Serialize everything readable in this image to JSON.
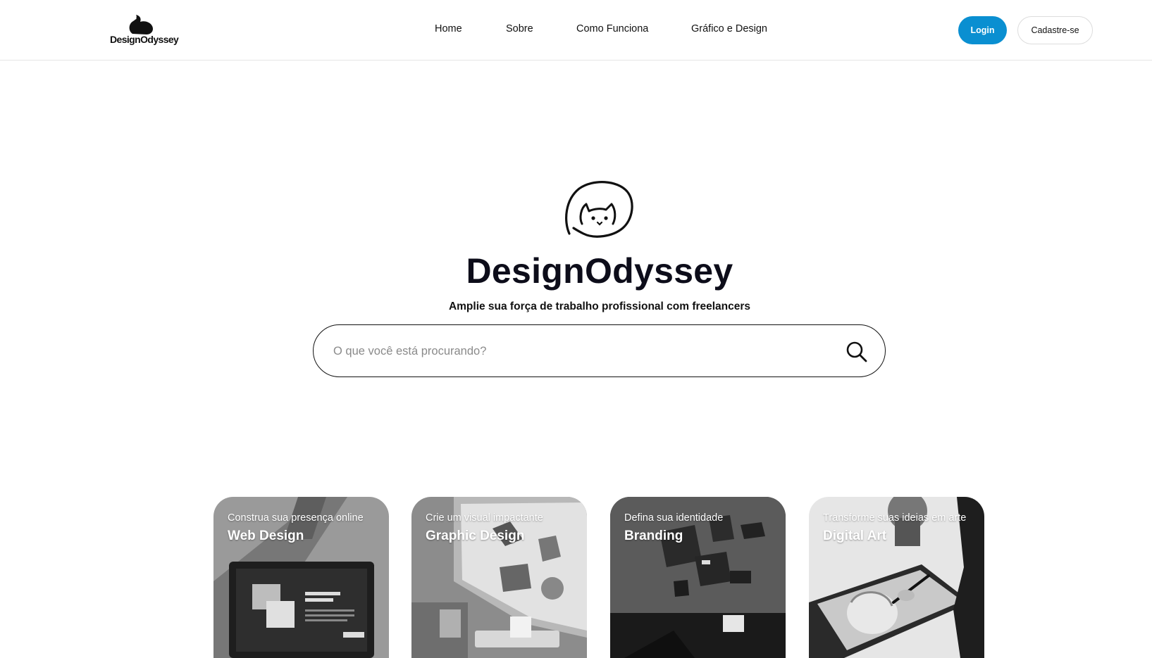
{
  "header": {
    "logo_text": "DesignOdyssey",
    "nav": [
      {
        "label": "Home"
      },
      {
        "label": "Sobre"
      },
      {
        "label": "Como Funciona"
      },
      {
        "label": "Gráfico e Design"
      }
    ],
    "login_label": "Login",
    "signup_label": "Cadastre-se",
    "accent_color": "#0a8fd1"
  },
  "hero": {
    "icon": "cat-face-icon",
    "title": "DesignOdyssey",
    "subtitle": "Amplie sua força de trabalho profissional com freelancers",
    "search": {
      "placeholder": "O que você está procurando?",
      "value": "",
      "icon": "search-icon"
    }
  },
  "categories": [
    {
      "subtitle": "Construa sua presença online",
      "title": "Web Design"
    },
    {
      "subtitle": "Crie um visual impactante",
      "title": "Graphic Design"
    },
    {
      "subtitle": "Defina sua identidade",
      "title": "Branding"
    },
    {
      "subtitle": "Transforme suas ideias em arte",
      "title": "Digital Art"
    }
  ]
}
